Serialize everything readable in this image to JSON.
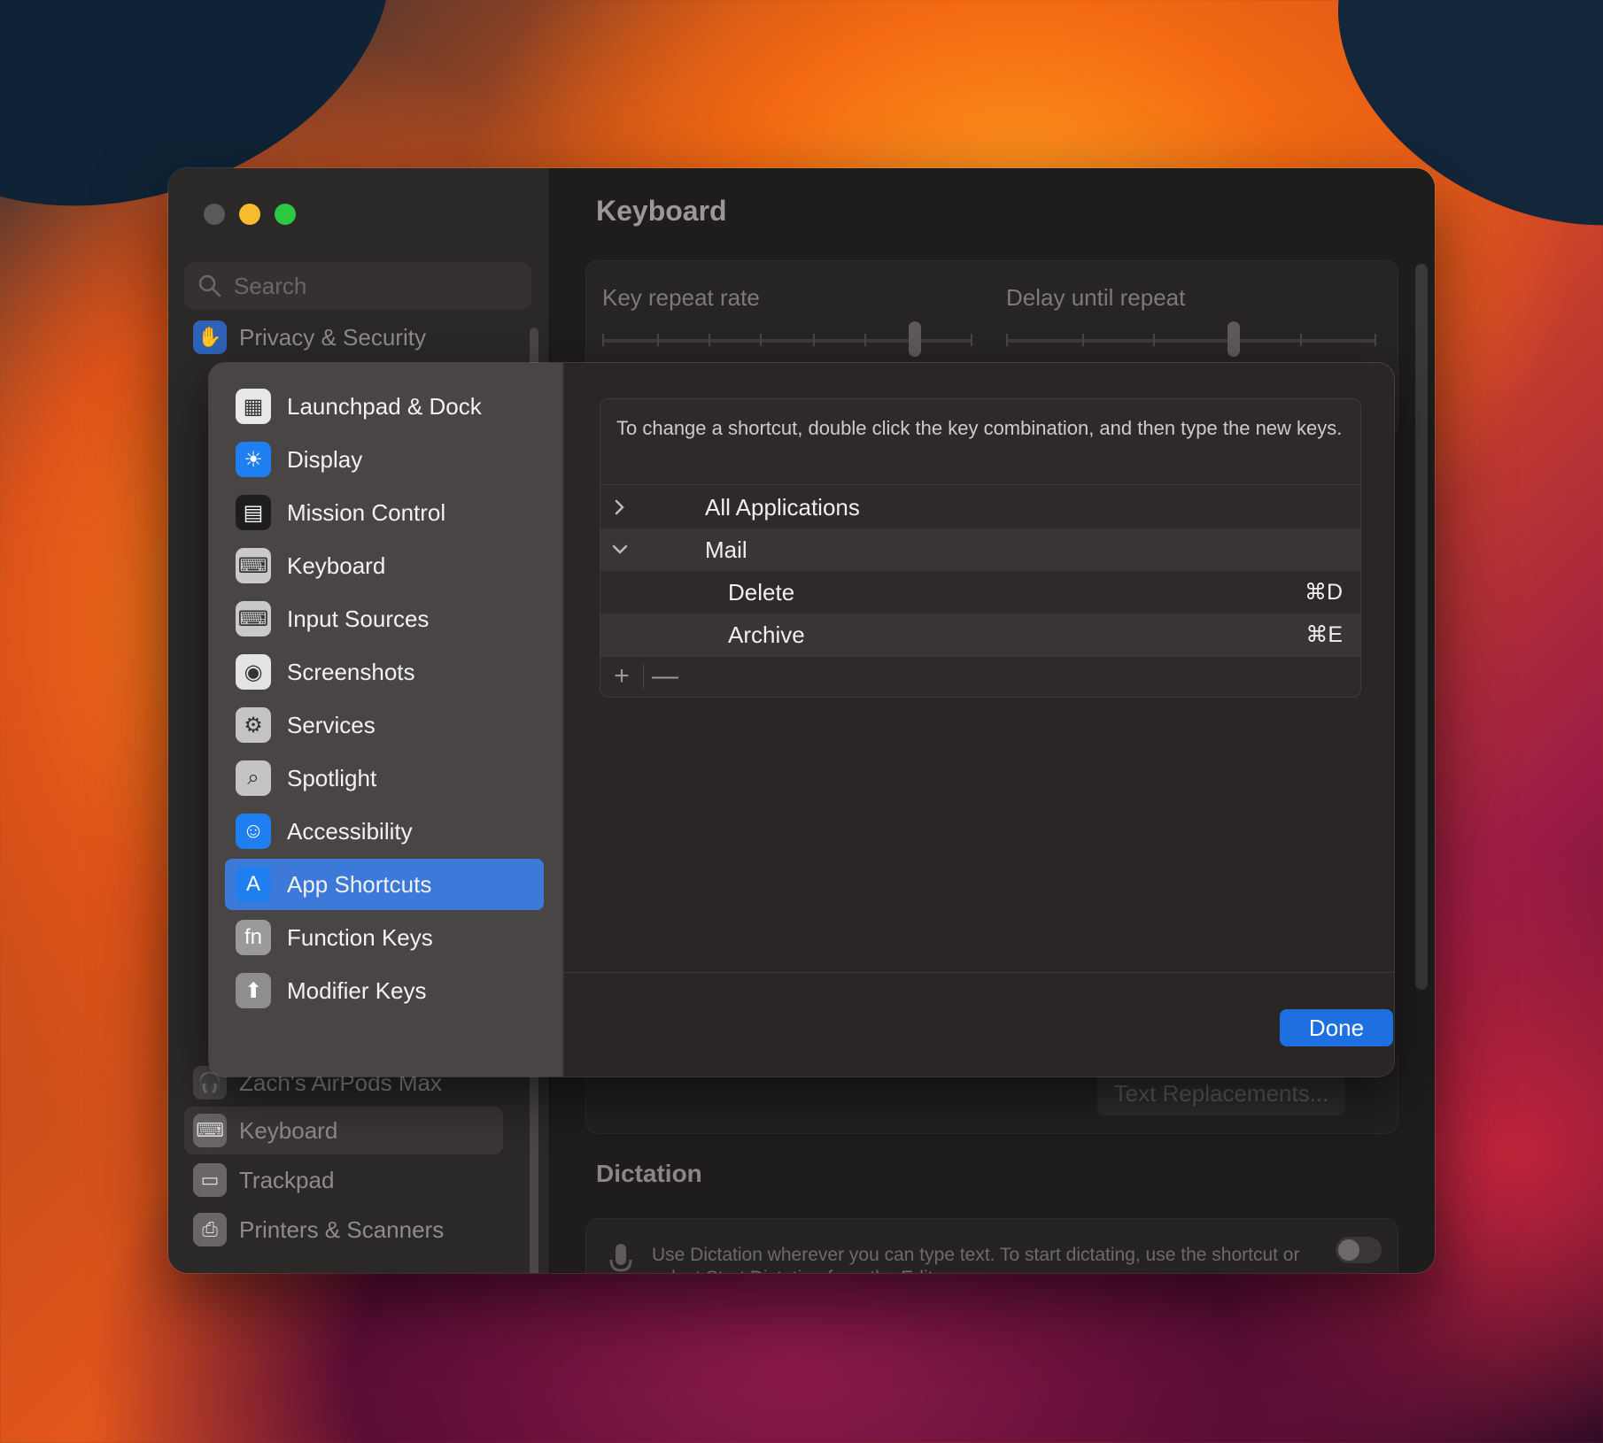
{
  "window": {
    "sidebar": {
      "search_placeholder": "Search",
      "top_item": {
        "label": "Privacy & Security",
        "icon": "hand-icon"
      },
      "bottom_items": [
        {
          "label": "Zach's AirPods Max",
          "icon": "headphones-icon"
        },
        {
          "label": "Keyboard",
          "icon": "keyboard-icon",
          "selected": true
        },
        {
          "label": "Trackpad",
          "icon": "trackpad-icon"
        },
        {
          "label": "Printers & Scanners",
          "icon": "printer-icon"
        }
      ]
    },
    "main": {
      "title": "Keyboard",
      "key_repeat_label": "Key repeat rate",
      "delay_repeat_label": "Delay until repeat",
      "text_replacements_label": "Text Replacements...",
      "dictation_title": "Dictation",
      "dictation_text": "Use Dictation wherever you can type text. To start dictating, use the shortcut or select Start Dictation from the Edit menu."
    }
  },
  "sheet": {
    "sidebar_items": [
      {
        "label": "Launchpad & Dock",
        "icon": "launchpad-icon",
        "color": "#e8e8e8"
      },
      {
        "label": "Display",
        "icon": "sun-icon",
        "color": "#1f7ef0"
      },
      {
        "label": "Mission Control",
        "icon": "mission-control-icon",
        "color": "#1e1e1e"
      },
      {
        "label": "Keyboard",
        "icon": "keyboard-icon",
        "color": "#c9c9c9"
      },
      {
        "label": "Input Sources",
        "icon": "keyboard-icon",
        "color": "#c9c9c9"
      },
      {
        "label": "Screenshots",
        "icon": "camera-icon",
        "color": "#e3e3e3"
      },
      {
        "label": "Services",
        "icon": "gears-icon",
        "color": "#c4c4c4"
      },
      {
        "label": "Spotlight",
        "icon": "magnifier-icon",
        "color": "#c4c4c4"
      },
      {
        "label": "Accessibility",
        "icon": "accessibility-icon",
        "color": "#1f7ef0"
      },
      {
        "label": "App Shortcuts",
        "icon": "app-store-icon",
        "color": "#1f7ef0",
        "selected": true
      },
      {
        "label": "Function Keys",
        "icon": "fn-icon",
        "color": "#9a9a9a"
      },
      {
        "label": "Modifier Keys",
        "icon": "arrow-up-icon",
        "color": "#8e8e8e"
      }
    ],
    "info_text": "To change a shortcut, double click the key combination, and then type the new keys.",
    "rows": [
      {
        "label": "All Applications",
        "expanded": false
      },
      {
        "label": "Mail",
        "expanded": true
      }
    ],
    "shortcuts": [
      {
        "label": "Delete",
        "key": "⌘D"
      },
      {
        "label": "Archive",
        "key": "⌘E"
      }
    ],
    "add_label": "+",
    "remove_label": "—",
    "done_label": "Done"
  }
}
